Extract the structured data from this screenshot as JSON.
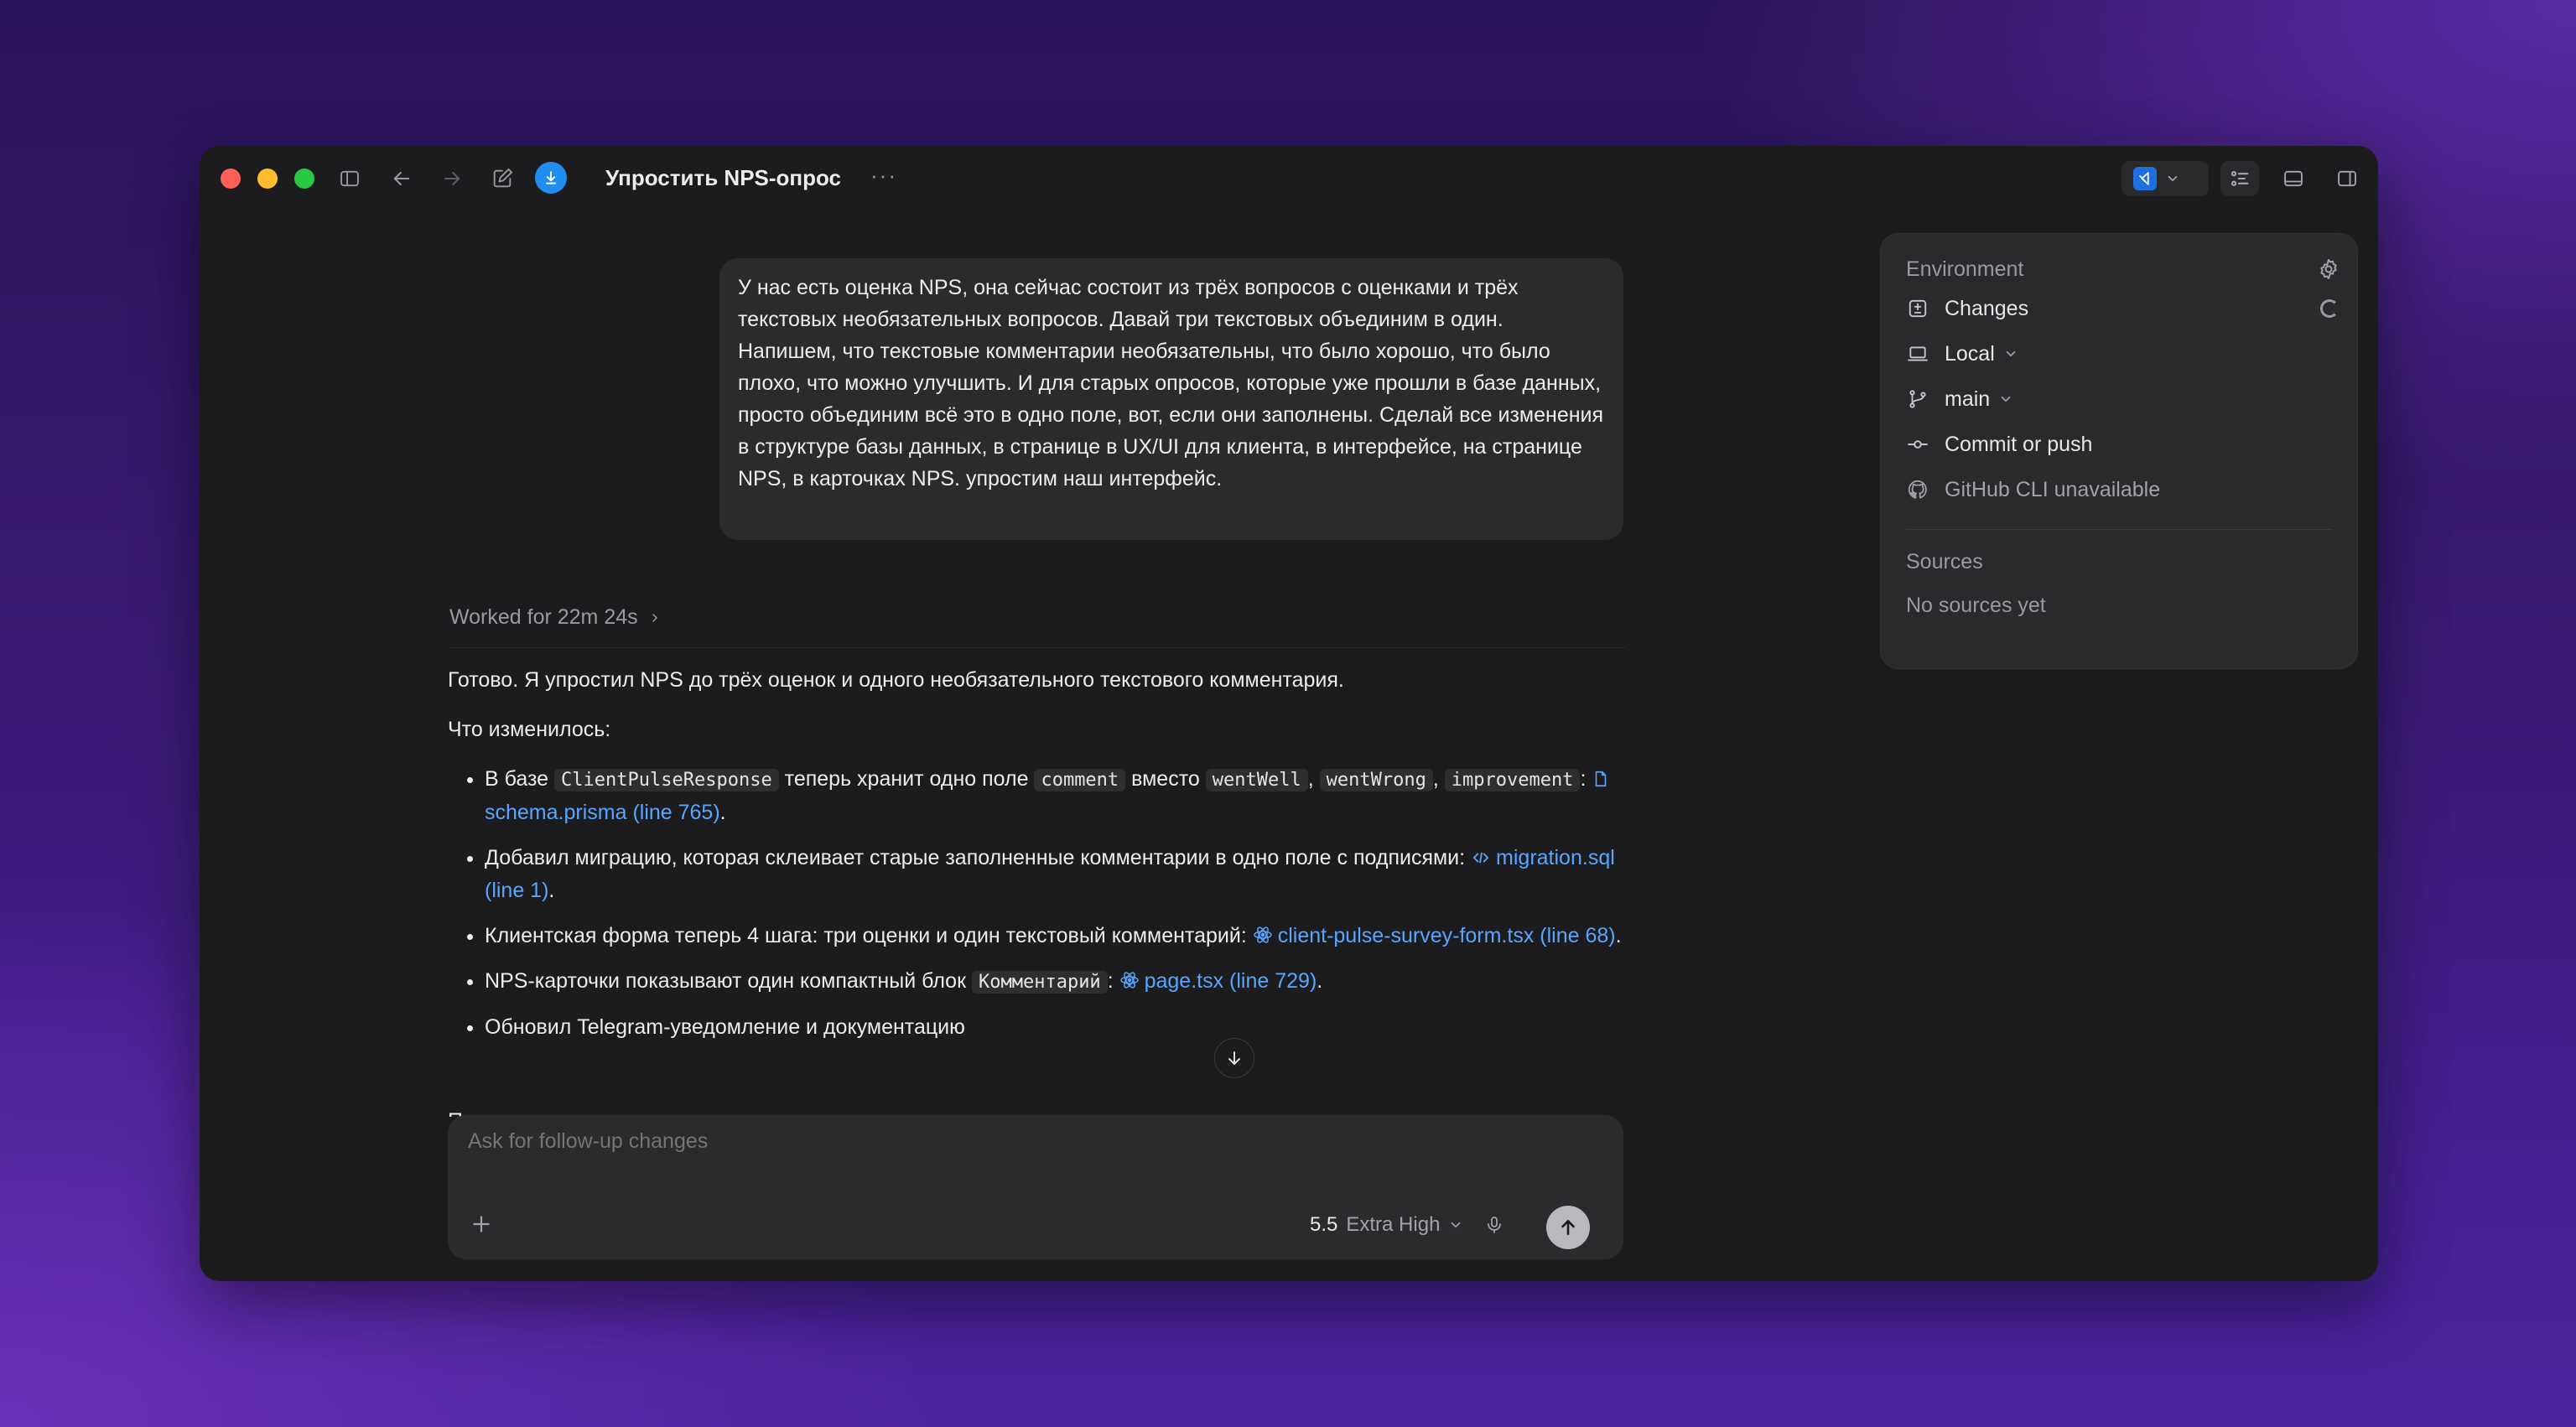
{
  "window": {
    "title": "Упростить NPS-опрос",
    "more_label": "···"
  },
  "user_message": "У нас есть оценка NPS, она сейчас состоит из трёх вопросов с оценками и трёх текстовых необязательных вопросов. Давай три текстовых объединим в один. Напишем, что текстовые комментарии необязательны, что было хорошо, что было плохо, что можно улучшить. И для старых опросов, которые уже прошли в базе данных, просто объединим всё это в одно поле, вот, если они заполнены. Сделай все изменения в структуре базы данных, в странице в UX/UI для клиента, в интерфейсе, на странице NPS, в карточках NPS. упростим наш интерфейс.",
  "worked_label": "Worked for 22m 24s",
  "answer": {
    "intro": "Готово. Я упростил NPS до трёх оценок и одного необязательного текстового комментария.",
    "changes_heading": "Что изменилось:",
    "item1": {
      "t1": "В базе ",
      "c1": "ClientPulseResponse",
      "t2": " теперь хранит одно поле ",
      "c2": "comment",
      "t3": " вместо ",
      "c3": "wentWell",
      "t4": ", ",
      "c4": "wentWrong",
      "t5": ", ",
      "c5": "improvement",
      "t6": ": ",
      "link": "schema.prisma (line 765)",
      "t7": "."
    },
    "item2": {
      "t1": "Добавил миграцию, которая склеивает старые заполненные комментарии в одно поле с подписями: ",
      "link": "migration.sql (line 1)",
      "t2": "."
    },
    "item3": {
      "t1": "Клиентская форма теперь 4 шага: три оценки и один текстовый комментарий: ",
      "link": "client-pulse-survey-form.tsx (line 68)",
      "t2": "."
    },
    "item4": {
      "t1": "NPS-карточки показывают один компактный блок ",
      "c1": "Комментарий",
      "t2": ": ",
      "link": "page.tsx (line 729)",
      "t3": "."
    },
    "item5": {
      "t1": "Обновил Telegram-уведомление и документацию"
    },
    "cut_letter": "П"
  },
  "composer": {
    "placeholder": "Ask for follow-up changes",
    "model_version": "5.5",
    "model_level": "Extra High"
  },
  "panel": {
    "heading": "Environment",
    "rows": [
      {
        "label": "Changes"
      },
      {
        "label": "Local"
      },
      {
        "label": "main"
      },
      {
        "label": "Commit or push"
      },
      {
        "label": "GitHub CLI unavailable"
      }
    ],
    "sources_heading": "Sources",
    "sources_empty": "No sources yet"
  },
  "colors": {
    "link": "#58a6ff",
    "accent_blue": "#1f8ef0",
    "window_bg": "#1c1c1e"
  }
}
